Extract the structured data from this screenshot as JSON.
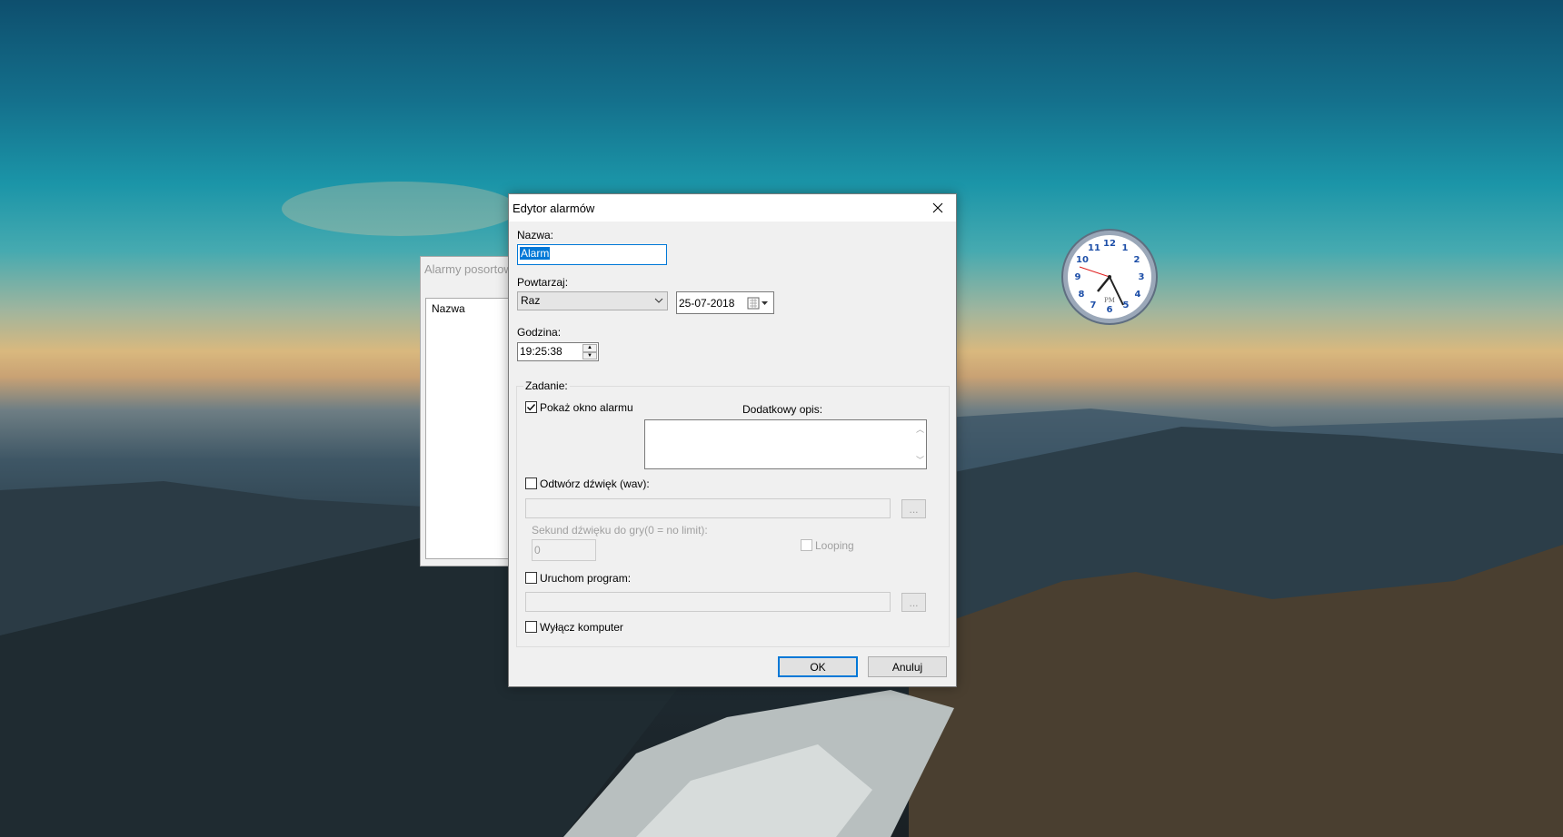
{
  "desktop": {
    "clock_widget": {
      "period": "PM",
      "numerals": [
        "12",
        "1",
        "2",
        "3",
        "4",
        "5",
        "6",
        "7",
        "8",
        "9",
        "10",
        "11"
      ]
    }
  },
  "background_window": {
    "title": "Alarmy posortowane",
    "list_header": "Nazwa"
  },
  "dialog": {
    "title": "Edytor alarmów",
    "name_label": "Nazwa:",
    "name_value": "Alarm",
    "repeat_label": "Powtarzaj:",
    "repeat_value": "Raz",
    "date_value": "25-07-2018",
    "time_label": "Godzina:",
    "time_value": "19:25:38",
    "task_group_label": "Zadanie:",
    "show_window_label": "Pokaż okno alarmu",
    "show_window_checked": true,
    "extra_desc_label": "Dodatkowy opis:",
    "play_sound_label": "Odtwórz dźwięk (wav):",
    "sound_path_value": "",
    "browse_label": "...",
    "seconds_label": "Sekund dźwięku do gry(0 = no limit):",
    "seconds_value": "0",
    "looping_label": "Looping",
    "run_program_label": "Uruchom program:",
    "program_path_value": "",
    "shutdown_label": "Wyłącz komputer",
    "ok_label": "OK",
    "cancel_label": "Anuluj"
  },
  "colors": {
    "accent": "#0078d7",
    "clock_numerals": "#1e4fa8",
    "second_hand": "#e02020"
  }
}
